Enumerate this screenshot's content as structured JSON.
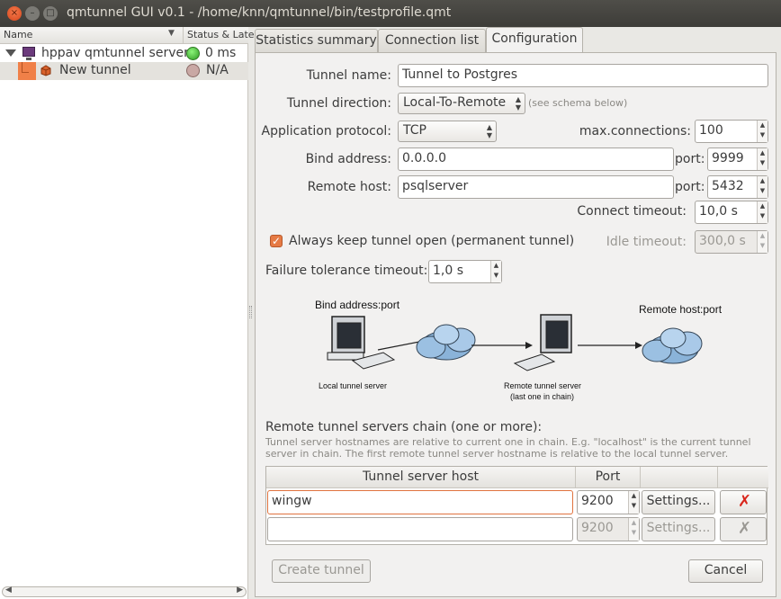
{
  "window": {
    "title": "qmtunnel GUI v0.1 - /home/knn/qmtunnel/bin/testprofile.qmt",
    "close_glyph": "×",
    "minimize_glyph": "–",
    "maximize_glyph": "□"
  },
  "tree": {
    "col_name": "Name",
    "col_status": "Status & Latency",
    "server": {
      "label": "hppav qmtunnel server",
      "status": "0 ms",
      "status_color": "#2f9a23",
      "icon": "monitor-icon"
    },
    "tunnel": {
      "label": "New tunnel",
      "status": "N/A",
      "status_color": "#c9a8a4",
      "icon": "tunnel-icon"
    }
  },
  "tabs": [
    {
      "label": "Statistics summary"
    },
    {
      "label": "Connection list"
    },
    {
      "label": "Configuration"
    }
  ],
  "active_tab": "Configuration",
  "config": {
    "tunnel_name_label": "Tunnel name:",
    "tunnel_name_value": "Tunnel to Postgres",
    "direction_label": "Tunnel direction:",
    "direction_value": "Local-To-Remote",
    "direction_hint": "(see schema below)",
    "protocol_label": "Application protocol:",
    "protocol_value": "TCP",
    "maxconn_label": "max.connections:",
    "maxconn_value": "100",
    "bind_label": "Bind address:",
    "bind_value": "0.0.0.0",
    "bind_port_label": "port:",
    "bind_port_value": "9999",
    "remote_label": "Remote host:",
    "remote_value": "psqlserver",
    "remote_port_label": "port:",
    "remote_port_value": "5432",
    "connect_timeout_label": "Connect timeout:",
    "connect_timeout_value": "10,0 s",
    "always_open_label": "Always keep tunnel open (permanent tunnel)",
    "always_open_checked": true,
    "idle_timeout_label": "Idle timeout:",
    "idle_timeout_value": "300,0 s",
    "failure_label": "Failure tolerance timeout:",
    "failure_value": "1,0 s"
  },
  "diagram": {
    "bind_label": "Bind address:port",
    "remote_label": "Remote host:port",
    "local_server": "Local tunnel server",
    "remote_server_line1": "Remote tunnel server",
    "remote_server_line2": "(last one in chain)"
  },
  "chain": {
    "title": "Remote tunnel servers chain (one or more):",
    "note": "Tunnel server hostnames are relative to current one in chain. E.g. \"localhost\" is the current tunnel server in chain. The first remote tunnel server hostname is relative to the local tunnel server.",
    "col_host": "Tunnel server host",
    "col_port": "Port",
    "rows": [
      {
        "host": "wingw",
        "port": "9200",
        "settings": "Settings...",
        "enabled": true
      },
      {
        "host": "",
        "port": "9200",
        "settings": "Settings...",
        "enabled": false
      }
    ]
  },
  "buttons": {
    "create": "Create tunnel",
    "cancel": "Cancel"
  }
}
